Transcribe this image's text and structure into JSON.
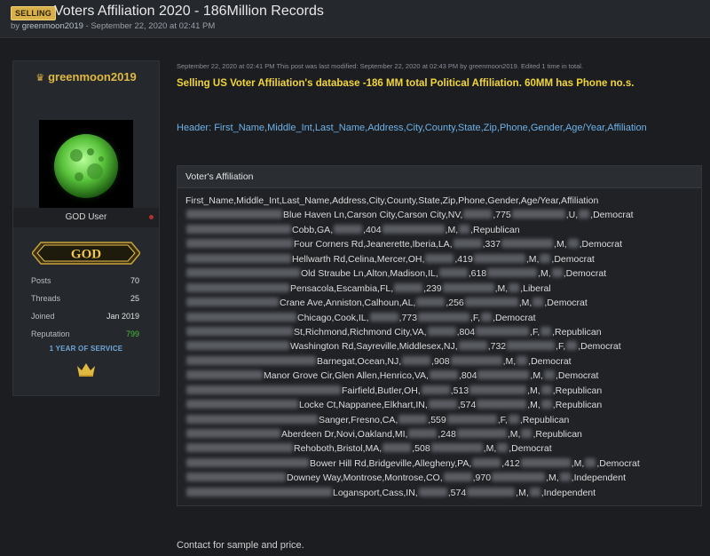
{
  "thread": {
    "badge": "SELLING",
    "title": "Voters Affiliation 2020 - 186Million Records",
    "byline_prefix": "by ",
    "author": "greenmoon2019",
    "byline_date": " - September 22, 2020 at 02:41 PM"
  },
  "user": {
    "name": "greenmoon2019",
    "title": "GOD User",
    "rank": "GOD",
    "stats": [
      {
        "label": "Posts",
        "value": "70"
      },
      {
        "label": "Threads",
        "value": "25"
      },
      {
        "label": "Joined",
        "value": "Jan 2019"
      },
      {
        "label": "Reputation",
        "value": "799"
      }
    ],
    "service": "1 YEAR OF SERVICE",
    "colors": {
      "name": "#e0b940",
      "reputation": "#4cbb3a",
      "status_dot": "#b03030"
    },
    "icons": {
      "crown": "crown-icon",
      "status": "status-dot-icon",
      "avatar": "moon-avatar"
    }
  },
  "post": {
    "meta": "September 22, 2020 at 02:41 PM  This post was last modified: September 22, 2020 at 02:43 PM by greenmoon2019. Edited 1 time in total.",
    "headline": "Selling US Voter Affiliation's database -186 MM total Political Affiliation. 60MM has Phone no.s.",
    "header_fields": "Header: First_Name,Middle_Int,Last_Name,Address,City,County,State,Zip,Phone,Gender,Age/Year,Affiliation",
    "code_title": "Voter's Affiliation",
    "code_header": "First_Name,Middle_Int,Last_Name,Address,City,County,State,Zip,Phone,Gender,Age/Year,Affiliation",
    "rows": [
      {
        "a": "Blue Haven Ln,Carson City,Carson City,NV,",
        "b": ",775",
        "c": ",U,",
        "d": ",Democrat"
      },
      {
        "a": "Cobb,GA,",
        "b": ",404",
        "c": ",M,",
        "d": ",Republican"
      },
      {
        "a": "Four Corners Rd,Jeanerette,Iberia,LA,",
        "b": ",337",
        "c": ",M,",
        "d": ",Democrat"
      },
      {
        "a": "Hellwarth Rd,Celina,Mercer,OH,",
        "b": ",419",
        "c": ",M,",
        "d": ",Democrat"
      },
      {
        "a": "Old Straube Ln,Alton,Madison,IL,",
        "b": ",618",
        "c": ",M,",
        "d": ",Democrat"
      },
      {
        "a": "Pensacola,Escambia,FL,",
        "b": ",239",
        "c": ",M,",
        "d": ",Liberal"
      },
      {
        "a": "Crane Ave,Anniston,Calhoun,AL,",
        "b": ",256",
        "c": ",M,",
        "d": ",Democrat"
      },
      {
        "a": "Chicago,Cook,IL,",
        "b": ",773",
        "c": ",F,",
        "d": ",Democrat"
      },
      {
        "a": "St,Richmond,Richmond City,VA,",
        "b": ",804",
        "c": ",F,",
        "d": ",Republican"
      },
      {
        "a": "Washington Rd,Sayreville,Middlesex,NJ,",
        "b": ",732",
        "c": ",F,",
        "d": ",Democrat"
      },
      {
        "a": "Barnegat,Ocean,NJ,",
        "b": ",908",
        "c": ",M,",
        "d": ",Democrat"
      },
      {
        "a": "Manor Grove Cir,Glen Allen,Henrico,VA,",
        "b": ",804",
        "c": ",M,",
        "d": ",Democrat"
      },
      {
        "a": "Fairfield,Butler,OH,",
        "b": ",513",
        "c": ",M,",
        "d": ",Republican"
      },
      {
        "a": "Locke Ct,Nappanee,Elkhart,IN,",
        "b": ",574",
        "c": ",M,",
        "d": ",Republican"
      },
      {
        "a": "Sanger,Fresno,CA,",
        "b": ",559",
        "c": ",F,",
        "d": ",Republican"
      },
      {
        "a": "Aberdeen Dr,Novi,Oakland,MI,",
        "b": ",248",
        "c": ",M,",
        "d": ",Republican"
      },
      {
        "a": "Rehoboth,Bristol,MA,",
        "b": ",508",
        "c": ",M,",
        "d": ",Democrat"
      },
      {
        "a": "Bower Hill Rd,Bridgeville,Allegheny,PA,",
        "b": ",412",
        "c": ",M,",
        "d": ",Democrat"
      },
      {
        "a": "Downey Way,Montrose,Montrose,CO,",
        "b": ",970",
        "c": ",M,",
        "d": ",Independent"
      },
      {
        "a": "Logansport,Cass,IN,",
        "b": ",574",
        "c": ",M,",
        "d": ",Independent"
      }
    ],
    "contact": "Contact for sample and price."
  }
}
